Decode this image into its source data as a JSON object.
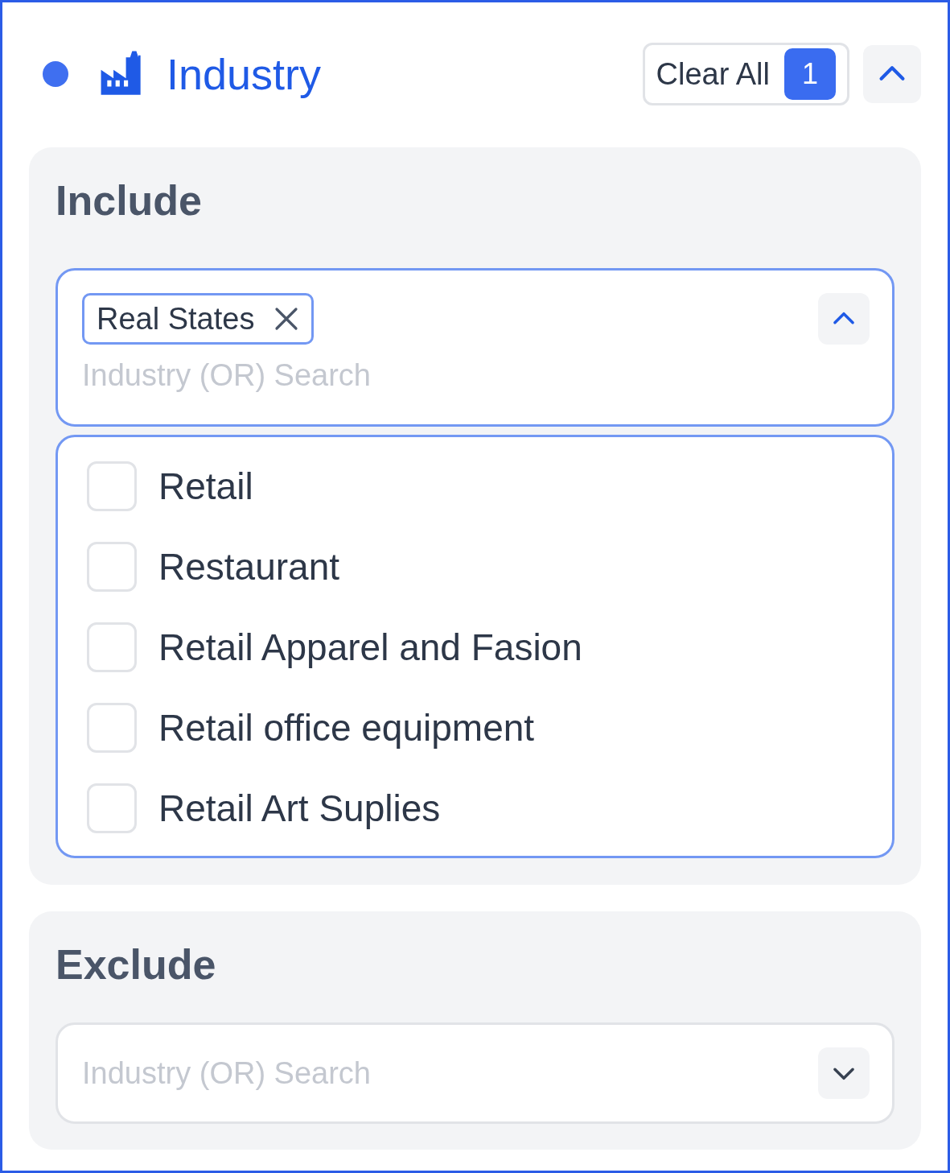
{
  "header": {
    "title": "Industry",
    "clear_button": "Clear All",
    "count": "1",
    "expanded": true
  },
  "include": {
    "heading": "Include",
    "chips": [
      {
        "label": "Real States"
      }
    ],
    "placeholder": "Industry (OR) Search",
    "expanded": true,
    "options": [
      {
        "label": "Retail",
        "checked": false
      },
      {
        "label": "Restaurant",
        "checked": false
      },
      {
        "label": "Retail Apparel and Fasion",
        "checked": false
      },
      {
        "label": "Retail office equipment",
        "checked": false
      },
      {
        "label": "Retail Art Suplies",
        "checked": false
      }
    ]
  },
  "exclude": {
    "heading": "Exclude",
    "placeholder": "Industry (OR) Search",
    "expanded": false
  }
}
